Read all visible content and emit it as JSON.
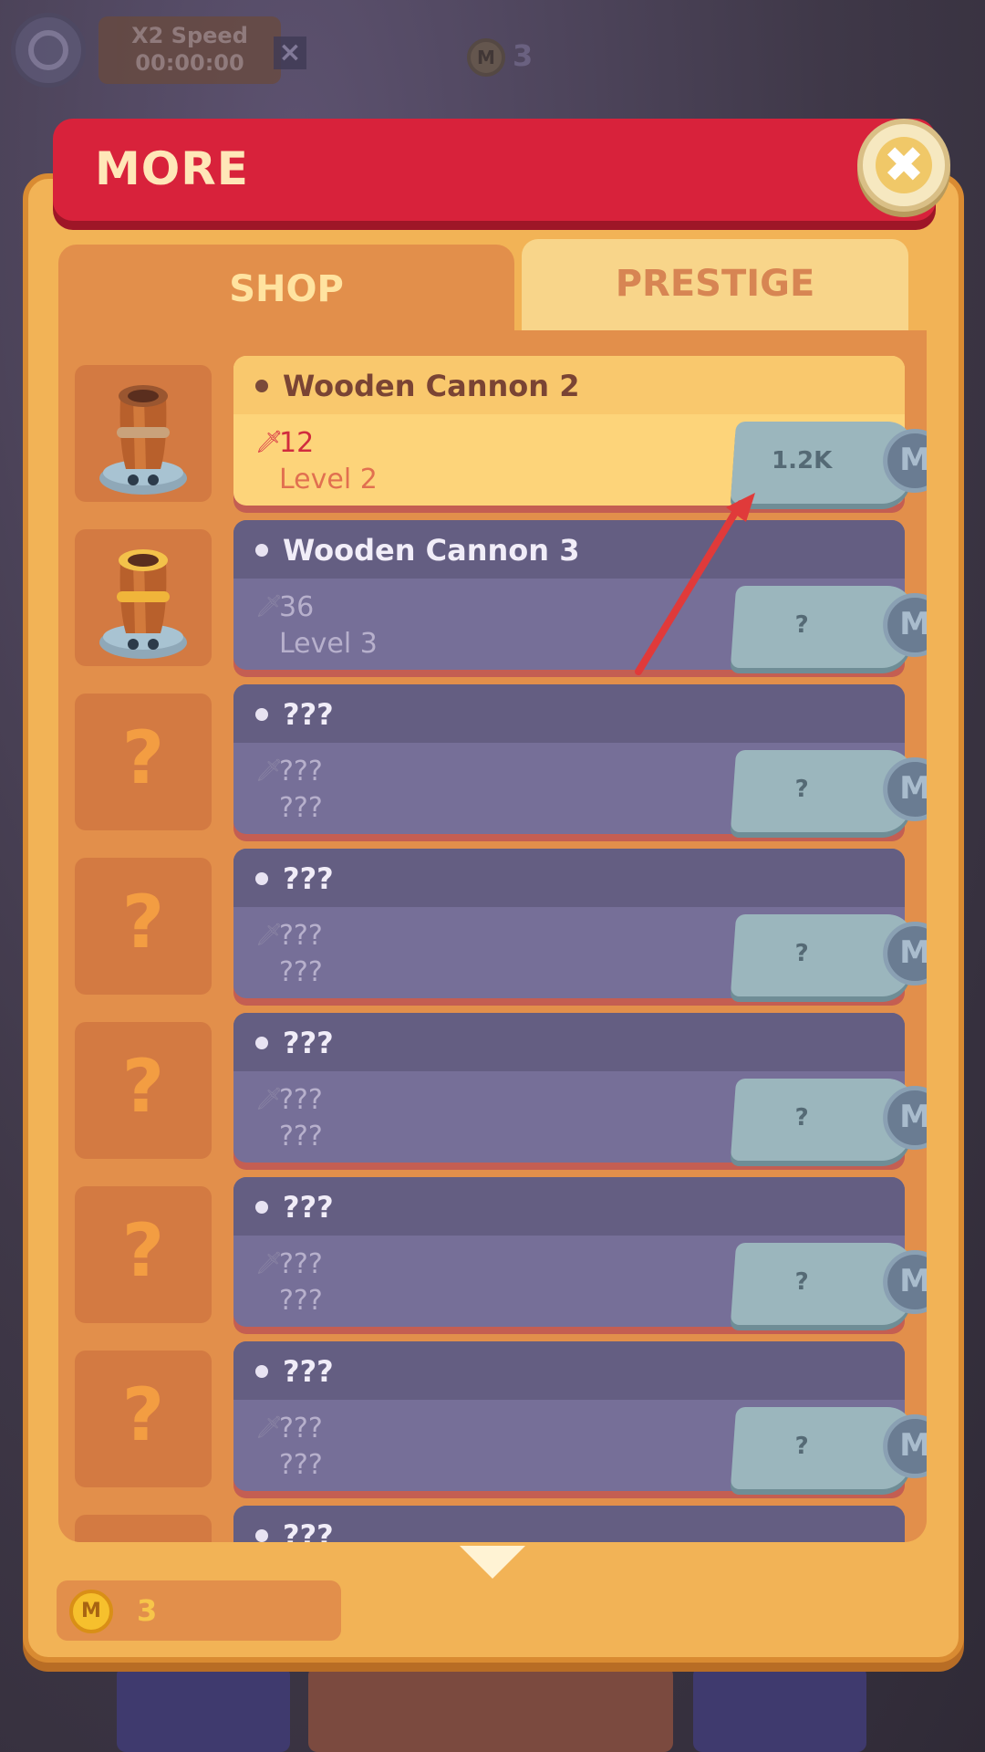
{
  "hud": {
    "speed_label": "X2 Speed",
    "speed_timer": "00:00:00",
    "coin_count": "3",
    "coin_letter": "M"
  },
  "header": {
    "title": "MORE",
    "close_icon": "close-icon"
  },
  "tabs": [
    {
      "label": "SHOP",
      "active": true
    },
    {
      "label": "PRESTIGE",
      "active": false
    }
  ],
  "items": [
    {
      "name": "Wooden Cannon 2",
      "damage": "12",
      "level": "Level 2",
      "price": "1.2K",
      "state": "active",
      "thumb": "wooden-cannon-2"
    },
    {
      "name": "Wooden Cannon 3",
      "damage": "36",
      "level": "Level 3",
      "price": "?",
      "state": "locked",
      "thumb": "wooden-cannon-3"
    },
    {
      "name": "???",
      "damage": "???",
      "level": "???",
      "price": "?",
      "state": "locked",
      "thumb": "?"
    },
    {
      "name": "???",
      "damage": "???",
      "level": "???",
      "price": "?",
      "state": "locked",
      "thumb": "?"
    },
    {
      "name": "???",
      "damage": "???",
      "level": "???",
      "price": "?",
      "state": "locked",
      "thumb": "?"
    },
    {
      "name": "???",
      "damage": "???",
      "level": "???",
      "price": "?",
      "state": "locked",
      "thumb": "?"
    },
    {
      "name": "???",
      "damage": "???",
      "level": "???",
      "price": "?",
      "state": "locked",
      "thumb": "?"
    },
    {
      "name": "???",
      "damage": "???",
      "level": "???",
      "price": "?",
      "state": "locked",
      "thumb": "?"
    }
  ],
  "currency_letter": "M",
  "footer": {
    "coins": "3"
  },
  "colors": {
    "panel": "#f2b356",
    "header": "#d8223b",
    "locked_card": "#766f98",
    "active_card": "#fdd47a",
    "annotation": "#e03a3a"
  }
}
